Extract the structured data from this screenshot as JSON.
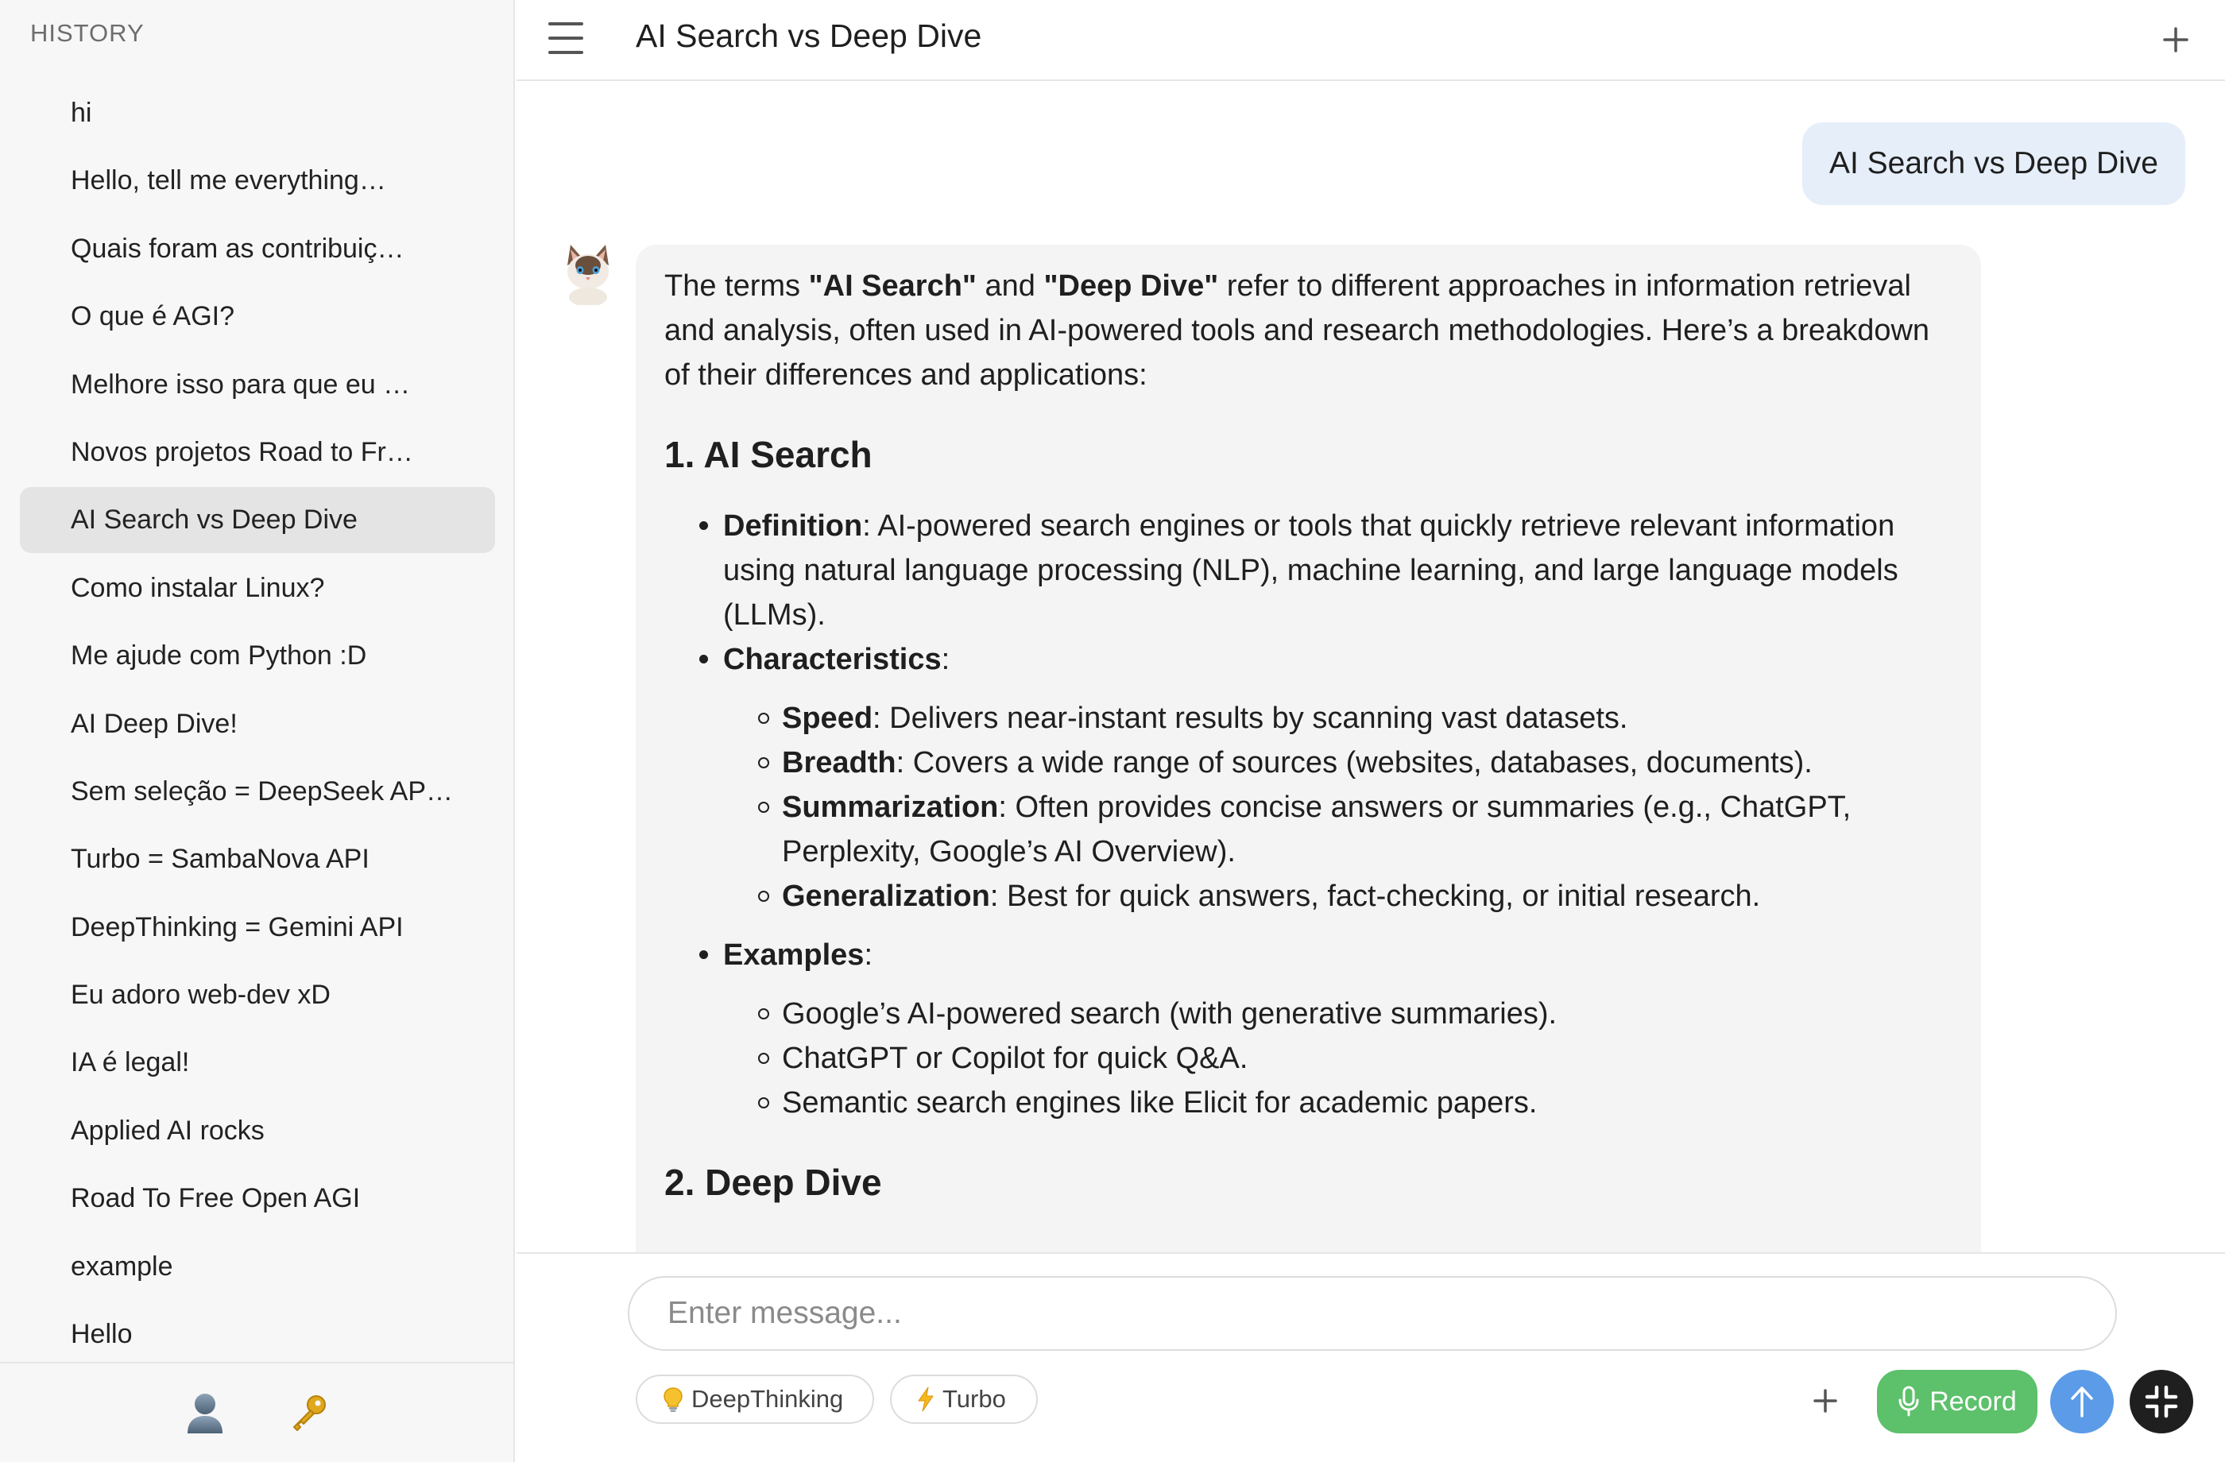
{
  "sidebar": {
    "history_label": "HISTORY",
    "items": [
      {
        "label": "hi",
        "active": false
      },
      {
        "label": "Hello, tell me everything…",
        "active": false
      },
      {
        "label": "Quais foram as contribuiç…",
        "active": false
      },
      {
        "label": "O que é AGI?",
        "active": false
      },
      {
        "label": "Melhore isso para que eu …",
        "active": false
      },
      {
        "label": "Novos projetos Road to Fr…",
        "active": false
      },
      {
        "label": "AI Search vs Deep Dive",
        "active": true
      },
      {
        "label": "Como instalar Linux?",
        "active": false
      },
      {
        "label": "Me ajude com Python :D",
        "active": false
      },
      {
        "label": "AI Deep Dive!",
        "active": false
      },
      {
        "label": "Sem seleção = DeepSeek AP…",
        "active": false
      },
      {
        "label": "Turbo = SambaNova API",
        "active": false
      },
      {
        "label": "DeepThinking = Gemini API",
        "active": false
      },
      {
        "label": "Eu adoro web-dev xD",
        "active": false
      },
      {
        "label": "IA é legal!",
        "active": false
      },
      {
        "label": "Applied AI rocks",
        "active": false
      },
      {
        "label": "Road To Free Open AGI",
        "active": false
      },
      {
        "label": "example",
        "active": false
      },
      {
        "label": "Hello",
        "active": false
      }
    ],
    "footer_icons": [
      "user-icon",
      "key-icon"
    ]
  },
  "header": {
    "title": "AI Search vs Deep Dive",
    "menu_icon": "hamburger-menu-icon",
    "new_chat_icon": "plus-icon"
  },
  "conversation": {
    "user_message": "AI Search vs Deep Dive",
    "assistant": {
      "intro": {
        "t1": "The terms ",
        "b1": "\"AI Search\"",
        "t2": " and ",
        "b2": "\"Deep Dive\"",
        "t3": " refer to different approaches in information retrieval and analysis, often used in AI-powered tools and research methodologies. Here’s a breakdown of their differences and applications:"
      },
      "section1_title": "1. AI Search",
      "definition": {
        "term": "Definition",
        "text": ": AI-powered search engines or tools that quickly retrieve relevant information using natural language processing (NLP), machine learning, and large language models (LLMs)."
      },
      "characteristics": {
        "term": "Characteristics",
        "suffix": ":",
        "items": [
          {
            "term": "Speed",
            "text": ": Delivers near-instant results by scanning vast datasets."
          },
          {
            "term": "Breadth",
            "text": ": Covers a wide range of sources (websites, databases, documents)."
          },
          {
            "term": "Summarization",
            "text": ": Often provides concise answers or summaries (e.g., ChatGPT, Perplexity, Google’s AI Overview)."
          },
          {
            "term": "Generalization",
            "text": ": Best for quick answers, fact-checking, or initial research."
          }
        ]
      },
      "examples": {
        "term": "Examples",
        "suffix": ":",
        "items": [
          "Google’s AI-powered search (with generative summaries).",
          "ChatGPT or Copilot for quick Q&A.",
          "Semantic search engines like Elicit for academic papers."
        ]
      },
      "section2_title": "2. Deep Dive"
    }
  },
  "composer": {
    "placeholder": "Enter message...",
    "deepthinking_label": "DeepThinking",
    "turbo_label": "Turbo",
    "record_label": "Record",
    "colors": {
      "record": "#5cc16a",
      "send": "#5b9be8",
      "collapse": "#1f1f1f",
      "user_bubble": "#e5eef9",
      "assistant_bubble": "#f4f4f4"
    }
  }
}
